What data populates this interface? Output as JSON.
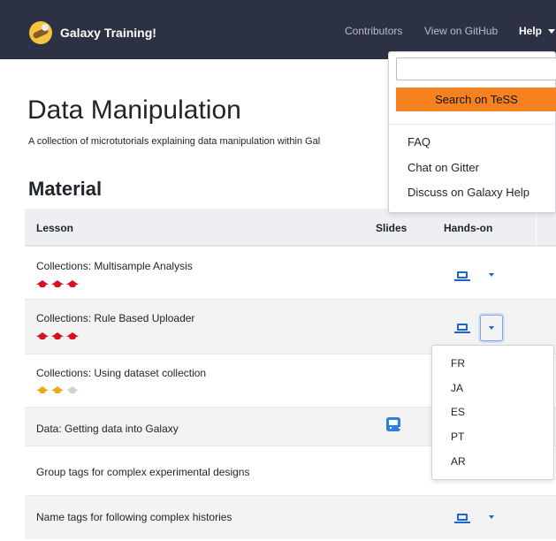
{
  "navbar": {
    "brand": "Galaxy Training!",
    "links": {
      "contributors": "Contributors",
      "github": "View on GitHub",
      "help": "Help"
    }
  },
  "help_menu": {
    "search_placeholder": "",
    "search_button": "Search on TeSS",
    "items": [
      "FAQ",
      "Chat on Gitter",
      "Discuss on Galaxy Help"
    ]
  },
  "page": {
    "title": "Data Manipulation",
    "description": "A collection of microtutorials explaining data manipulation within Gal",
    "section": "Material"
  },
  "table": {
    "headers": {
      "lesson": "Lesson",
      "slides": "Slides",
      "handson": "Hands-on"
    },
    "rows": [
      {
        "title": "Collections: Multisample Analysis",
        "level": 3,
        "max_level": 3,
        "level_color": "#d6101e"
      },
      {
        "title": "Collections: Rule Based Uploader",
        "level": 3,
        "max_level": 3,
        "level_color": "#d6101e"
      },
      {
        "title": "Collections: Using dataset collection",
        "level": 2,
        "max_level": 3,
        "level_color": "#f0a81e"
      },
      {
        "title": "Data: Getting data into Galaxy",
        "has_slides": true
      },
      {
        "title": "Group tags for complex experimental designs"
      },
      {
        "title": "Name tags for following complex histories"
      }
    ]
  },
  "language_menu": {
    "options": [
      "FR",
      "JA",
      "ES",
      "PT",
      "AR"
    ]
  },
  "colors": {
    "navbar": "#2c3143",
    "accent": "#1e63d3",
    "tess_button": "#f5821f"
  }
}
